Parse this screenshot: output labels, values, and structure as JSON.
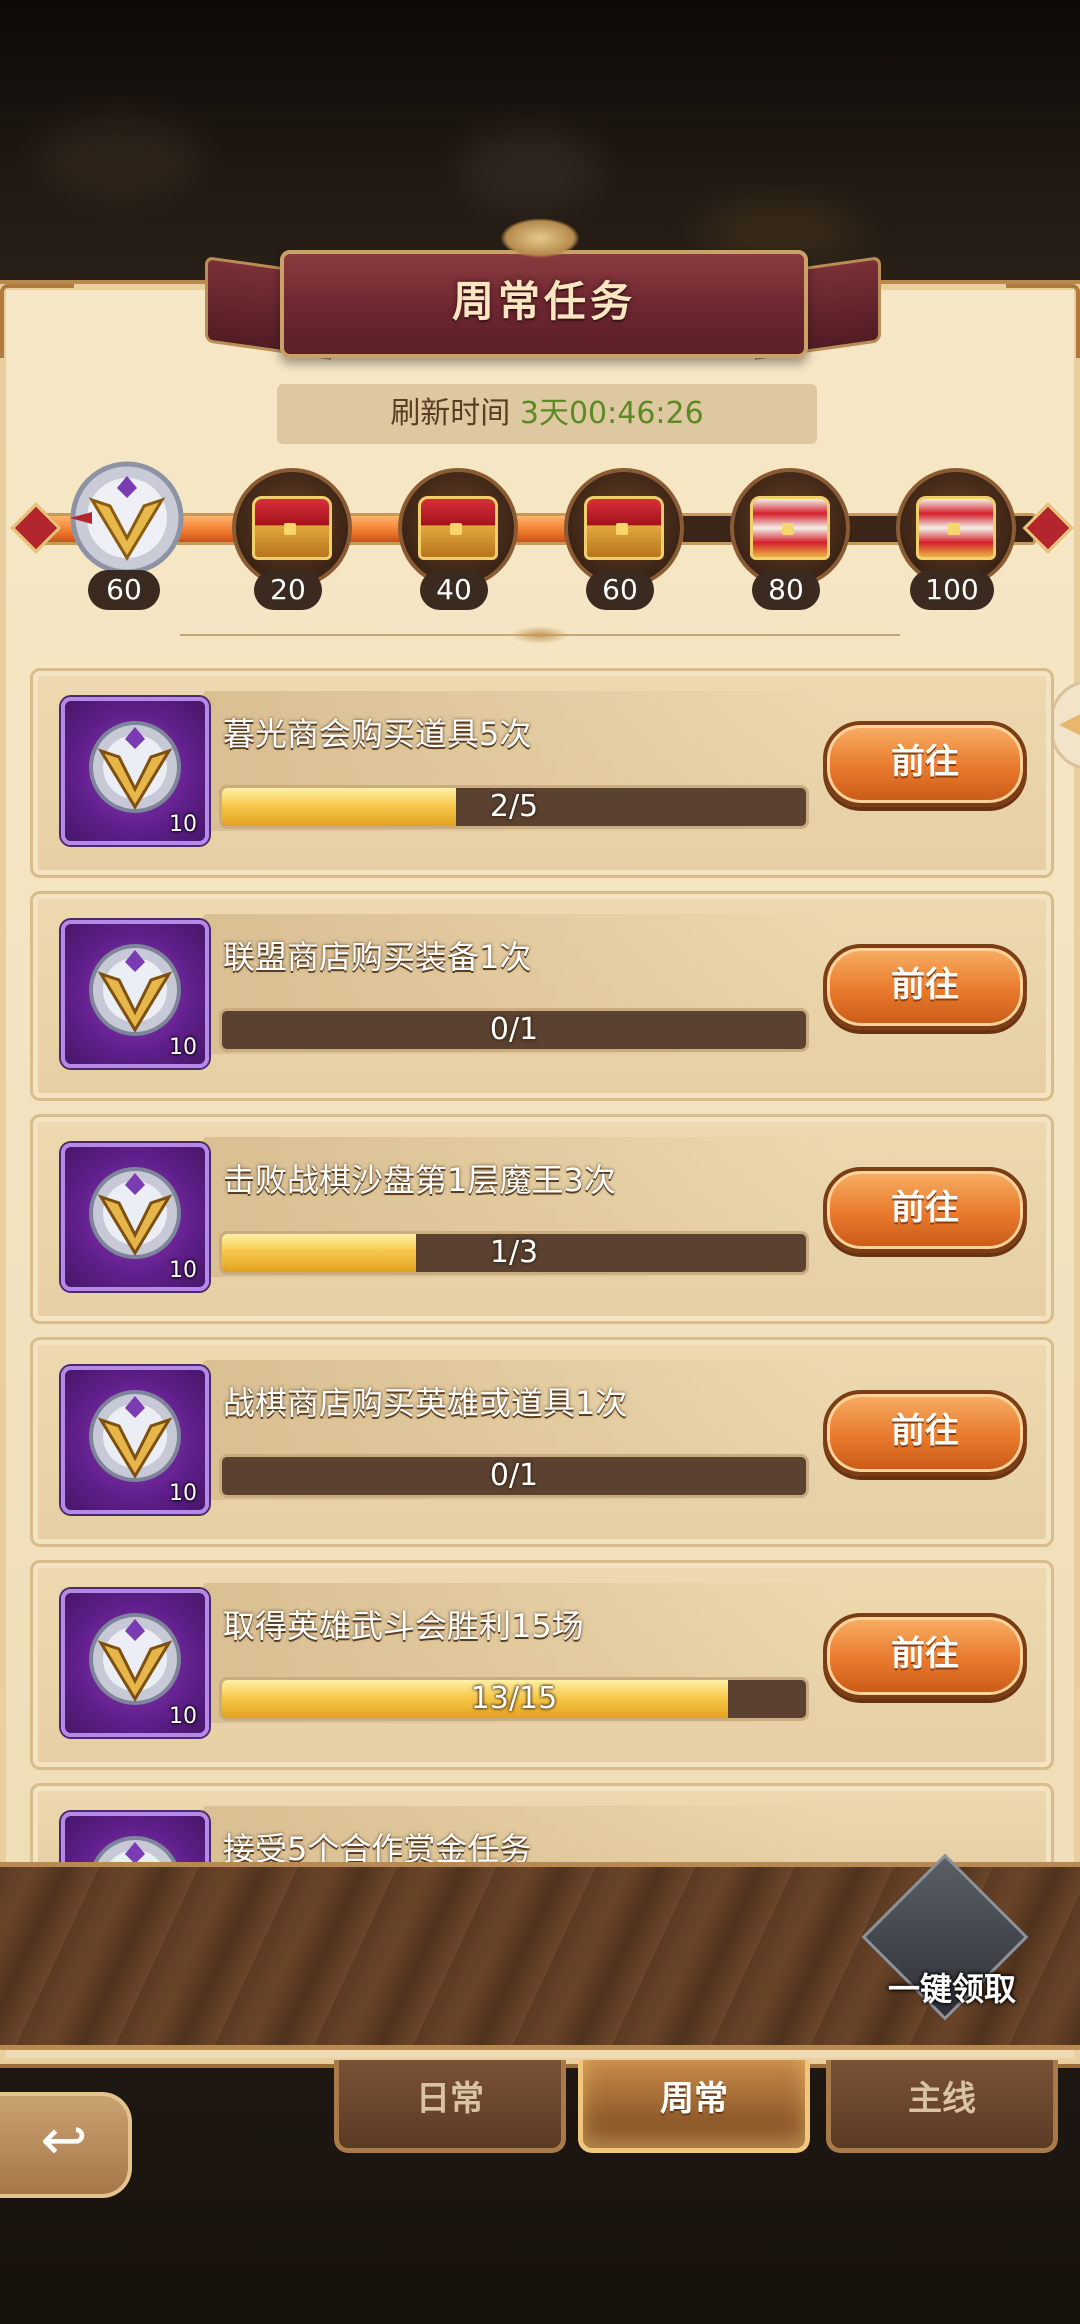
{
  "header": {
    "title": "周常任务",
    "refresh_label": "刷新时间",
    "refresh_time": "3天00:46:26"
  },
  "progress": {
    "current_points": "60",
    "current_fraction": 0.6,
    "milestones": [
      {
        "points": "20",
        "reward_icon": "treasure-chest-icon",
        "claimed": false
      },
      {
        "points": "40",
        "reward_icon": "treasure-chest-icon",
        "claimed": false
      },
      {
        "points": "60",
        "reward_icon": "treasure-chest-icon",
        "claimed": false
      },
      {
        "points": "80",
        "reward_icon": "gold-treasure-chest-icon",
        "claimed": false
      },
      {
        "points": "100",
        "reward_icon": "gold-treasure-chest-icon",
        "claimed": false
      }
    ]
  },
  "tasks": [
    {
      "title": "暮光商会购买道具5次",
      "progress": "2/5",
      "fraction": 0.4,
      "reward_qty": "10",
      "button": "前往"
    },
    {
      "title": "联盟商店购买装备1次",
      "progress": "0/1",
      "fraction": 0.0,
      "reward_qty": "10",
      "button": "前往"
    },
    {
      "title": "击败战棋沙盘第1层魔王3次",
      "progress": "1/3",
      "fraction": 0.333,
      "reward_qty": "10",
      "button": "前往"
    },
    {
      "title": "战棋商店购买英雄或道具1次",
      "progress": "0/1",
      "fraction": 0.0,
      "reward_qty": "10",
      "button": "前往"
    },
    {
      "title": "取得英雄武斗会胜利15场",
      "progress": "13/15",
      "fraction": 0.867,
      "reward_qty": "10",
      "button": "前往"
    },
    {
      "title": "接受5个合作赏金任务",
      "progress": "",
      "fraction": 0.0,
      "reward_qty": "",
      "button": ""
    }
  ],
  "footer": {
    "claim_all_label": "一键领取"
  },
  "tabs": [
    {
      "label": "日常",
      "active": false
    },
    {
      "label": "周常",
      "active": true
    },
    {
      "label": "主线",
      "active": false
    }
  ],
  "nav": {
    "back_icon": "back-arrow-icon"
  }
}
